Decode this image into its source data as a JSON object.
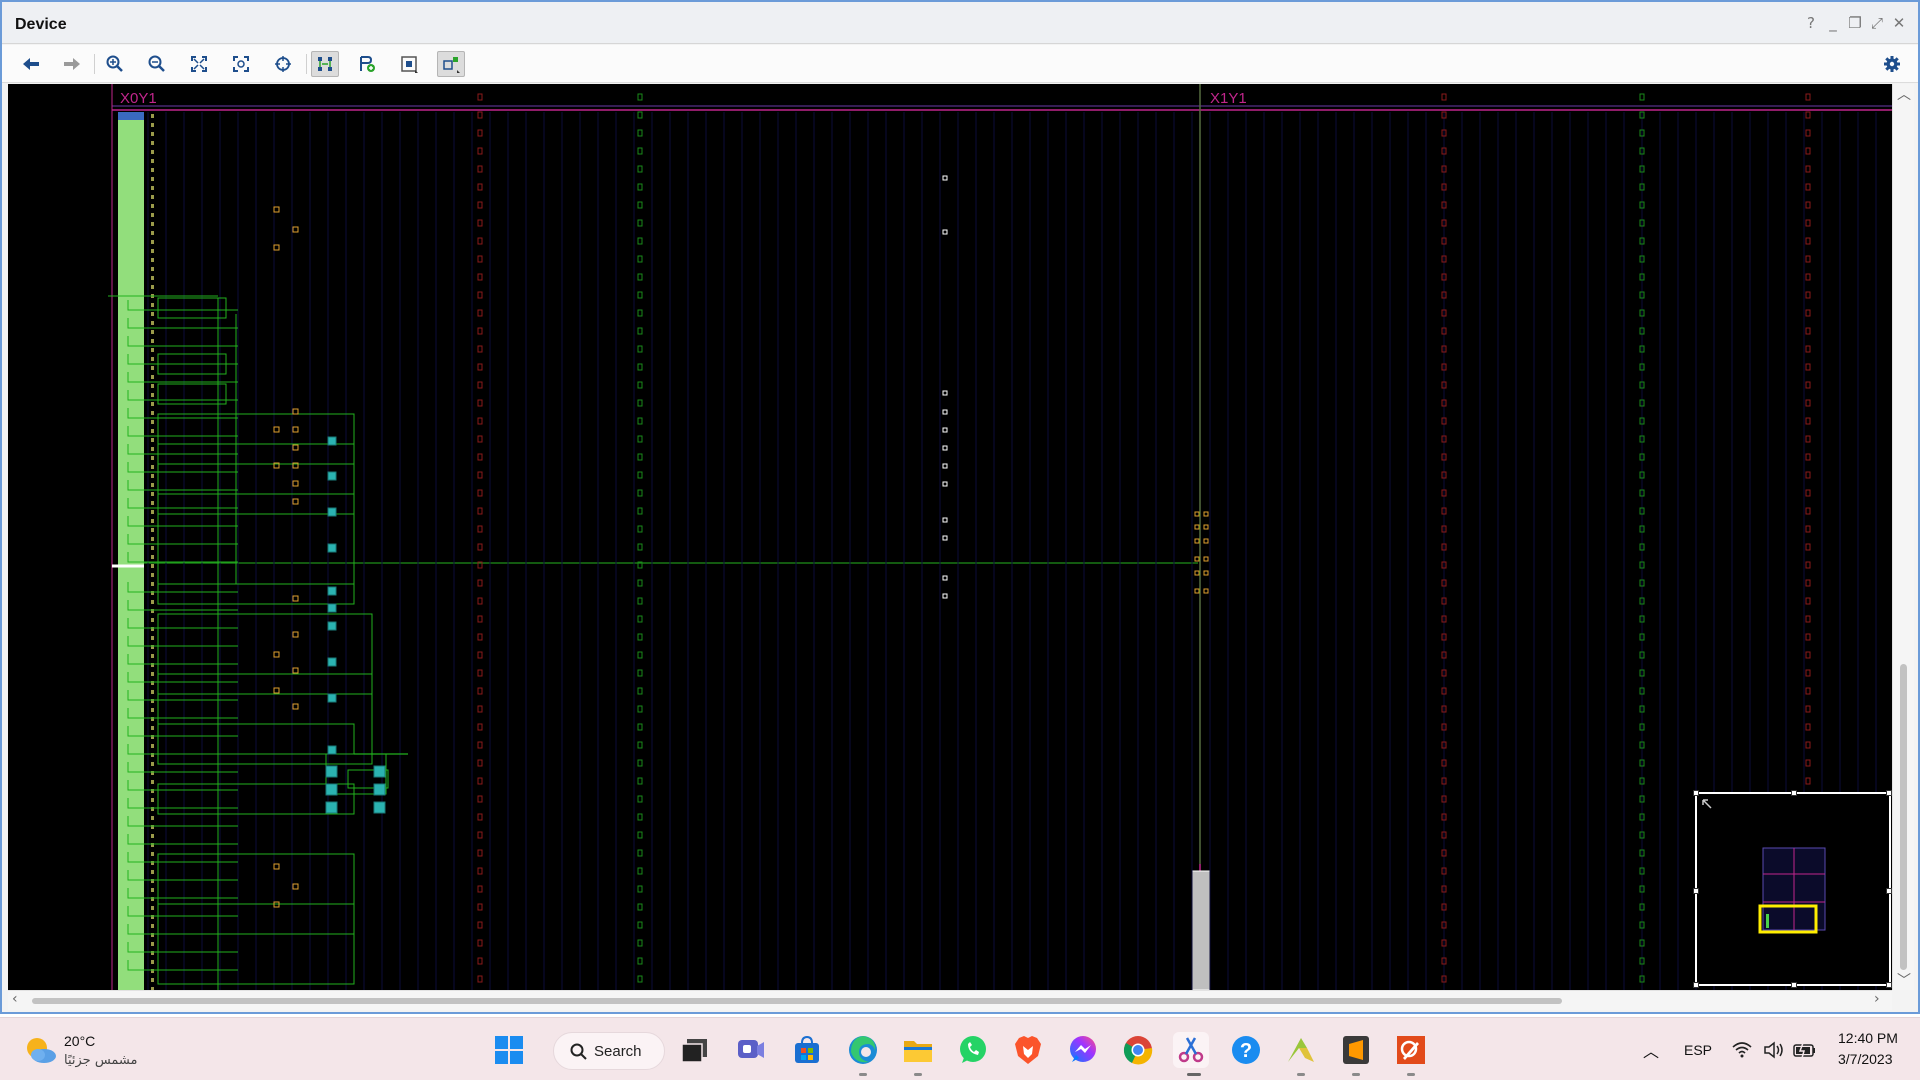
{
  "window": {
    "title": "Device",
    "controls": [
      "help-icon",
      "minimize-icon",
      "restore-icon",
      "float-icon",
      "close-icon"
    ]
  },
  "toolbar": {
    "buttons": [
      {
        "icon": "back-arrow-icon"
      },
      {
        "icon": "forward-arrow-icon"
      },
      {
        "icon": "zoom-in-icon"
      },
      {
        "icon": "zoom-out-icon"
      },
      {
        "icon": "zoom-fit-icon"
      },
      {
        "icon": "zoom-selected-icon"
      },
      {
        "icon": "crosshair-icon"
      },
      {
        "icon": "routing-resources-icon",
        "active": true
      },
      {
        "icon": "add-pblock-icon"
      },
      {
        "icon": "pblock-icon"
      },
      {
        "icon": "auto-fit-icon",
        "active": true
      }
    ],
    "settings_icon": "gear-icon"
  },
  "device": {
    "region_labels": [
      "X0Y1",
      "X1Y1"
    ],
    "colors": {
      "background": "#000000",
      "net": "#22b11e",
      "clock_region": "#c0268c",
      "cell": "#2bb3b1",
      "io": "#e0a030"
    }
  },
  "minimap": {
    "viewport_color": "#ffee00"
  },
  "taskbar": {
    "weather": {
      "temp": "20°C",
      "desc": "مشمس جزئيًا"
    },
    "search_label": "Search",
    "apps": [
      "windows-start-icon",
      "task-view-icon",
      "teams-icon",
      "store-icon",
      "edge-icon",
      "file-explorer-icon",
      "whatsapp-icon",
      "brave-icon",
      "messenger-icon",
      "chrome-icon",
      "snipping-tool-icon",
      "help-app-icon",
      "vivado-icon",
      "sublime-icon",
      "quartus-icon"
    ],
    "tray": {
      "language": "ESP",
      "time": "12:40 PM",
      "date": "3/7/2023"
    }
  }
}
